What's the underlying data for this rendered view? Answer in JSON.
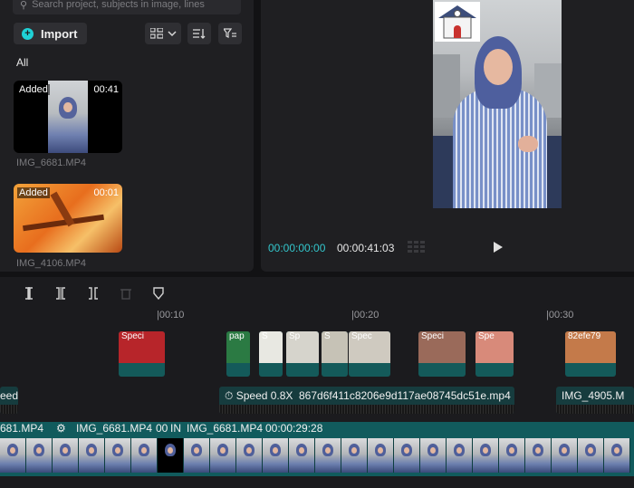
{
  "media": {
    "search_placeholder": "Search project, subjects in image, lines",
    "import_label": "Import",
    "filter_all": "All",
    "items": [
      {
        "badge": "Added",
        "duration": "00:41",
        "name": "IMG_6681.MP4"
      },
      {
        "badge": "Added",
        "duration": "00:01",
        "name": "IMG_4106.MP4"
      }
    ]
  },
  "player": {
    "current_time": "00:00:00:00",
    "total_time": "00:00:41:03"
  },
  "timeline": {
    "ruler": [
      "|00:10",
      "|00:20",
      "|00:30"
    ],
    "overlay_clips": [
      {
        "label": "Speci"
      },
      {
        "label": "pap"
      },
      {
        "label": "S"
      },
      {
        "label": "Sp"
      },
      {
        "label": "S"
      },
      {
        "label": "Spec"
      },
      {
        "label": "Speci"
      },
      {
        "label": "Spe"
      },
      {
        "label": "82efe79"
      }
    ],
    "track2": {
      "left_label": "eed",
      "speed_label": "Speed 0.8X",
      "file_label": "867d6f411c8206e9d117ae08745dc51e.mp4",
      "right_label": "IMG_4905.M"
    },
    "main_track": {
      "seg1": "681.MP4",
      "seg2": "IMG_6681.MP4",
      "seg2b": "00",
      "seg3": "IN",
      "seg4": "IMG_6681.MP4",
      "seg4_time": "00:00:29:28"
    }
  }
}
